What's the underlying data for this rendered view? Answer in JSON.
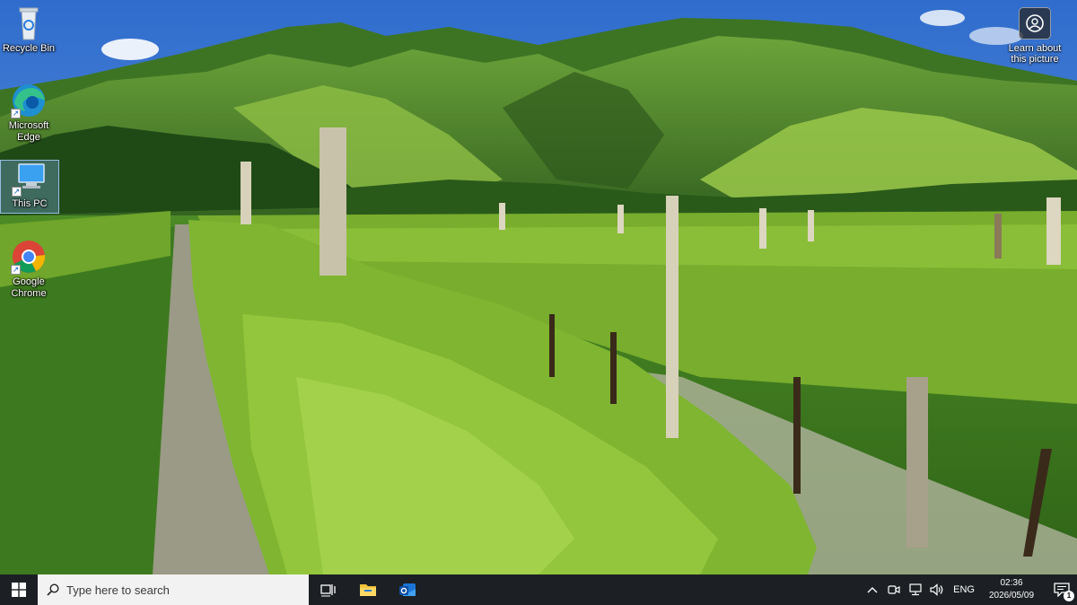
{
  "desktop": {
    "icons": [
      {
        "label": "Recycle Bin"
      },
      {
        "label": "Microsoft Edge"
      },
      {
        "label": "This PC"
      },
      {
        "label": "Google Chrome"
      }
    ],
    "learn_about": {
      "label": "Learn about this picture",
      "icon": "camera-icon"
    }
  },
  "taskbar": {
    "start_icon": "windows-logo-icon",
    "search_placeholder": "Type here to search",
    "pinned": [
      {
        "icon": "task-view-icon"
      },
      {
        "icon": "file-explorer-icon"
      },
      {
        "icon": "outlook-icon"
      }
    ],
    "tray": {
      "icons": [
        "chevron-up-icon",
        "meet-now-icon",
        "network-icon",
        "volume-icon"
      ],
      "language": "ENG",
      "time": "02:36",
      "date": "2026/05/09",
      "notification_count": "1"
    }
  },
  "colors": {
    "taskbar_bg": "#1c2024",
    "sky": "#3f7bd6",
    "hills": "#4f8a2a",
    "vines": "#7cae2e"
  }
}
